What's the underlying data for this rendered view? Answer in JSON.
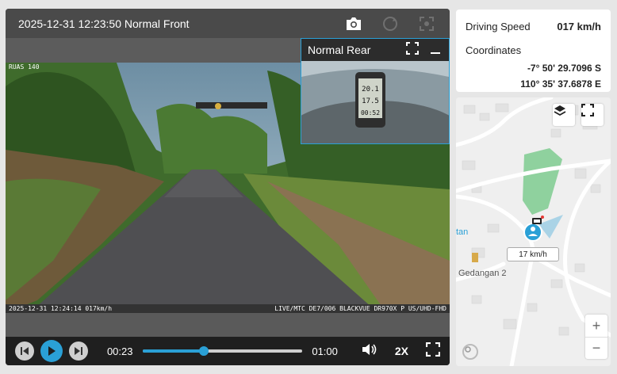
{
  "player": {
    "title": "2025-12-31 12:23:50 Normal Front",
    "icons": [
      "camera-icon",
      "refresh-icon",
      "fullscreen-exit-icon"
    ],
    "overlay_top": "RUAS 140",
    "overlay_bottom_left": "2025-12-31 12:24:14 017km/h",
    "overlay_bottom_right": "LIVE/MTC DE7/006 BLACKVUE DR970X P US/UHD-FHD"
  },
  "rear": {
    "title": "Normal Rear",
    "gps_readings": [
      "20.1",
      "17.5",
      "00:52"
    ]
  },
  "controls": {
    "current_time": "00:23",
    "duration": "01:00",
    "progress": 0.383,
    "speed": "2X"
  },
  "info": {
    "speed_label": "Driving Speed",
    "speed_value": "017 km/h",
    "coords_label": "Coordinates",
    "lat": "-7° 50' 29.7096 S",
    "lon": "110° 35' 37.6878 E"
  },
  "map": {
    "speed_label": "17 km/h",
    "place_label": "Gedangan 2",
    "partial_label": "tan",
    "zoom_in": "+",
    "zoom_out": "−",
    "colors": {
      "park": "#8fd19e",
      "accent": "#2aa0d6"
    }
  }
}
